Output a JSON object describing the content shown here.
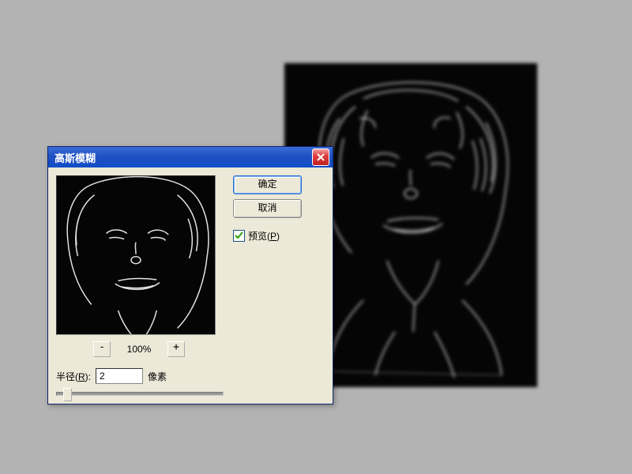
{
  "dialog": {
    "title": "高斯模糊",
    "ok_label": "确定",
    "cancel_label": "取消",
    "preview_label": "预览(",
    "preview_key": "P",
    "preview_suffix": ")",
    "preview_checked": true,
    "zoom_pct": "100%",
    "zoom_minus": "-",
    "zoom_plus": "+",
    "radius_label_prefix": "半径(",
    "radius_key": "R",
    "radius_label_suffix": "):",
    "radius_value": "2",
    "radius_unit": "像素"
  }
}
